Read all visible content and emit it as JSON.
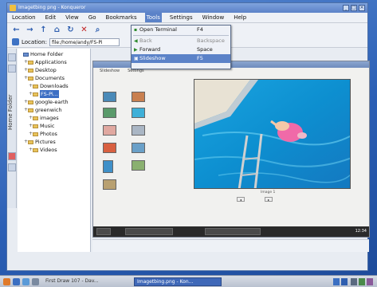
{
  "window": {
    "title": "Imagetbing png - Konqueror",
    "buttons": [
      "_",
      "□",
      "×"
    ]
  },
  "menubar": {
    "items": [
      "Location",
      "Edit",
      "View",
      "Go",
      "Bookmarks",
      "Tools",
      "Settings",
      "Window",
      "Help"
    ]
  },
  "location": {
    "label": "Location:",
    "value": "file:/home/andy/FS-Pi"
  },
  "tools_menu": {
    "items": [
      {
        "label": "Open Terminal",
        "shortcut": "F4",
        "icon": "terminal-icon"
      },
      {
        "label": "Back",
        "shortcut": "Backspace",
        "icon": "back-arrow-icon"
      },
      {
        "label": "Forward",
        "shortcut": "Space",
        "icon": "forward-arrow-icon"
      },
      {
        "label": "Slideshow",
        "shortcut": "F5",
        "icon": "slideshow-icon"
      }
    ]
  },
  "sidebar": {
    "tab_label": "Home Folder",
    "tree": [
      {
        "label": "Home Folder",
        "level": 0
      },
      {
        "label": "Applications",
        "level": 1
      },
      {
        "label": "Desktop",
        "level": 1
      },
      {
        "label": "Documents",
        "level": 1
      },
      {
        "label": "Downloads",
        "level": 2
      },
      {
        "label": "FS-Pi...",
        "level": 2,
        "selected": true
      },
      {
        "label": "google-earth",
        "level": 1
      },
      {
        "label": "greenwich",
        "level": 1
      },
      {
        "label": "images",
        "level": 2
      },
      {
        "label": "Music",
        "level": 2
      },
      {
        "label": "Photos",
        "level": 2
      },
      {
        "label": "Pictures",
        "level": 1
      },
      {
        "label": "Videos",
        "level": 2
      }
    ]
  },
  "slideshow": {
    "tabs": [
      "Slideshow",
      "Settings"
    ],
    "caption": "Image 1",
    "clock": "12:34"
  },
  "taskbar": {
    "items": [
      "First Draw 107 - Dav...",
      "Imagetbing.png - Kon..."
    ]
  }
}
